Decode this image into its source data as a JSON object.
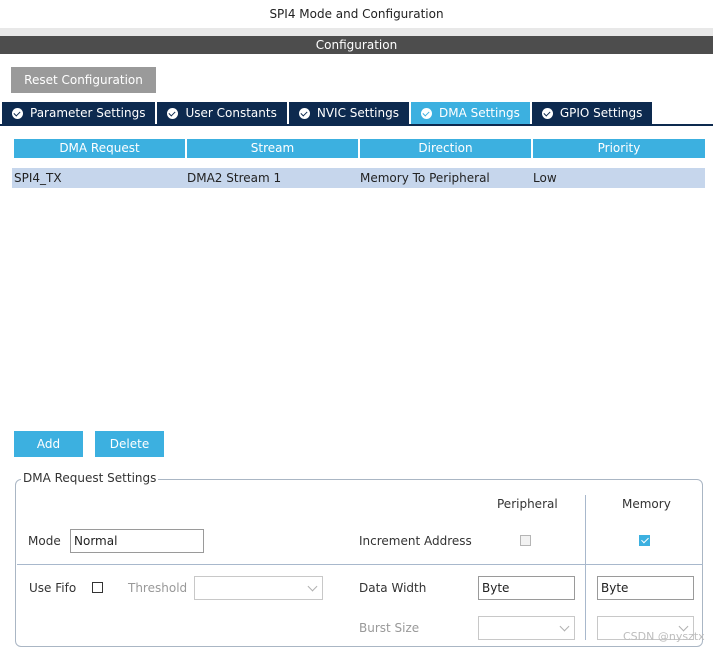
{
  "window": {
    "title": "SPI4 Mode and Configuration"
  },
  "config_bar": {
    "title": "Configuration"
  },
  "reset_button": {
    "label": "Reset Configuration"
  },
  "tabs": [
    {
      "label": "Parameter Settings",
      "active": false
    },
    {
      "label": "User Constants",
      "active": false
    },
    {
      "label": "NVIC Settings",
      "active": false
    },
    {
      "label": "DMA Settings",
      "active": true
    },
    {
      "label": "GPIO Settings",
      "active": false
    }
  ],
  "dma_table": {
    "columns": [
      "DMA Request",
      "Stream",
      "Direction",
      "Priority"
    ],
    "rows": [
      [
        "SPI4_TX",
        "DMA2 Stream 1",
        "Memory To Peripheral",
        "Low"
      ]
    ]
  },
  "buttons": {
    "add": "Add",
    "delete": "Delete"
  },
  "request_settings": {
    "legend": "DMA Request Settings",
    "peripheral_header": "Peripheral",
    "memory_header": "Memory",
    "mode_label": "Mode",
    "mode_value": "Normal",
    "increment_label": "Increment Address",
    "increment_peripheral": false,
    "increment_memory": true,
    "use_fifo_label": "Use Fifo",
    "use_fifo": false,
    "threshold_label": "Threshold",
    "threshold_value": "",
    "data_width_label": "Data Width",
    "data_width_peripheral": "Byte",
    "data_width_memory": "Byte",
    "burst_size_label": "Burst Size",
    "burst_size_peripheral": "",
    "burst_size_memory": ""
  },
  "watermark": "CSDN @nysztx",
  "colors": {
    "accent": "#3cb0e0",
    "tab_dark": "#0d2a4f",
    "header_bar": "#4d4d4d",
    "row_selected": "#c6d6ec"
  },
  "icons": {
    "tab_check": "check-circle-icon",
    "combo": "chevron-down-icon"
  }
}
